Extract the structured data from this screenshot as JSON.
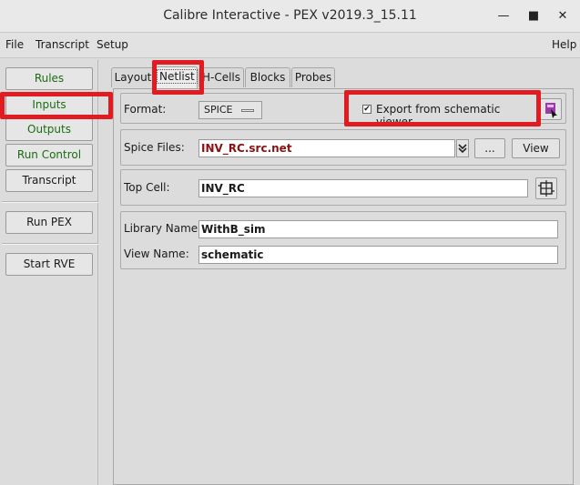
{
  "window": {
    "title": "Calibre Interactive - PEX v2019.3_15.11",
    "minimize_glyph": "—",
    "maximize_glyph": "■",
    "close_glyph": "✕"
  },
  "menubar": {
    "file": "File",
    "transcript": "Transcript",
    "setup": "Setup",
    "help": "Help"
  },
  "sidebar": {
    "rules": "Rules",
    "inputs": "Inputs",
    "outputs": "Outputs",
    "run_control": "Run Control",
    "transcript": "Transcript",
    "run_pex": "Run PEX",
    "start_rve": "Start RVE"
  },
  "tabs": {
    "layout": "Layout",
    "netlist": "Netlist",
    "hcells": "H-Cells",
    "blocks": "Blocks",
    "probes": "Probes",
    "active": "Netlist"
  },
  "netlist": {
    "format_label": "Format:",
    "format_value": "SPICE",
    "export_checked": true,
    "export_label": "Export from schematic viewer",
    "spice_files_label": "Spice Files:",
    "spice_files_value": "INV_RC.src.net",
    "browse_label": "...",
    "view_label": "View",
    "top_cell_label": "Top Cell:",
    "top_cell_value": "INV_RC",
    "library_name_label": "Library Name:",
    "library_name_value": "WithB_sim",
    "view_name_label": "View Name:",
    "view_name_value": "schematic"
  },
  "colors": {
    "highlight": "#e11b22",
    "sidebar_text": "#1a6d10",
    "file_value": "#8a1111"
  }
}
